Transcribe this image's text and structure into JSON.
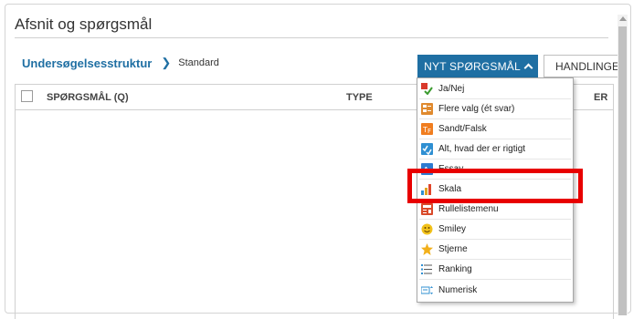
{
  "section": {
    "title": "Afsnit og spørgsmål"
  },
  "breadcrumb": {
    "link": "Undersøgelsesstruktur",
    "current": "Standard"
  },
  "toolbar": {
    "new_question_label": "NYT SPØRGSMÅL",
    "actions_label": "HANDLINGER"
  },
  "table": {
    "columns": [
      "SPØRGSMÅL (Q)",
      "TYPE",
      "ER"
    ]
  },
  "menu": {
    "items": [
      {
        "label": "Ja/Nej",
        "icon": "yes-no-icon"
      },
      {
        "label": "Flere valg (ét svar)",
        "icon": "multiple-choice-icon"
      },
      {
        "label": "Sandt/Falsk",
        "icon": "true-false-icon"
      },
      {
        "label": "Alt, hvad der er rigtigt",
        "icon": "all-that-apply-icon"
      },
      {
        "label": "Essay",
        "icon": "essay-icon"
      },
      {
        "label": "Skala",
        "icon": "scale-icon"
      },
      {
        "label": "Rullelistemenu",
        "icon": "dropdown-list-icon"
      },
      {
        "label": "Smiley",
        "icon": "smiley-icon"
      },
      {
        "label": "Stjerne",
        "icon": "star-icon"
      },
      {
        "label": "Ranking",
        "icon": "ranking-icon"
      },
      {
        "label": "Numerisk",
        "icon": "numeric-icon"
      }
    ]
  },
  "colors": {
    "accent": "#1f6fa3",
    "highlight": "#e80000"
  }
}
